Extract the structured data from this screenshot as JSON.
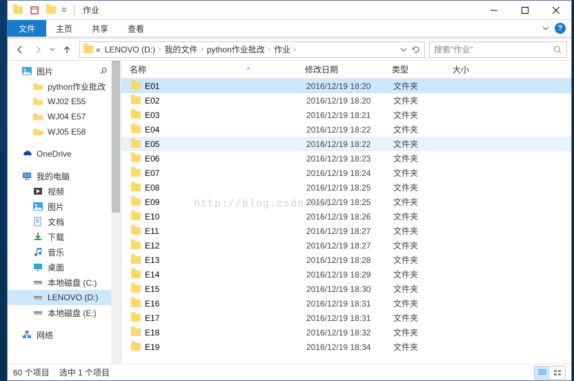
{
  "window": {
    "title": "作业"
  },
  "ribbon": {
    "file_tab": "文件",
    "tabs": [
      "主页",
      "共享",
      "查看"
    ]
  },
  "breadcrumbs": {
    "prefix": "«",
    "items": [
      "LENOVO (D:)",
      "我的文件",
      "python作业批改",
      "作业"
    ]
  },
  "search": {
    "placeholder": "搜索\"作业\""
  },
  "nav_pane": {
    "items": [
      {
        "label": "图片",
        "icon": "pictures",
        "indent": 0,
        "pin": true
      },
      {
        "label": "python作业批改",
        "icon": "folder",
        "indent": 1
      },
      {
        "label": "WJ02 E55",
        "icon": "folder",
        "indent": 1
      },
      {
        "label": "WJ04 E57",
        "icon": "folder",
        "indent": 1
      },
      {
        "label": "WJ05 E58",
        "icon": "folder",
        "indent": 1
      },
      {
        "spacer": true
      },
      {
        "label": "OneDrive",
        "icon": "onedrive",
        "indent": 0
      },
      {
        "spacer": true
      },
      {
        "label": "我的电脑",
        "icon": "thispc",
        "indent": 0
      },
      {
        "label": "视频",
        "icon": "videos",
        "indent": 1
      },
      {
        "label": "图片",
        "icon": "pictures",
        "indent": 1
      },
      {
        "label": "文档",
        "icon": "documents",
        "indent": 1
      },
      {
        "label": "下载",
        "icon": "downloads",
        "indent": 1
      },
      {
        "label": "音乐",
        "icon": "music",
        "indent": 1
      },
      {
        "label": "桌面",
        "icon": "desktop",
        "indent": 1
      },
      {
        "label": "本地磁盘 (C:)",
        "icon": "drive",
        "indent": 1
      },
      {
        "label": "LENOVO (D:)",
        "icon": "drive",
        "indent": 1,
        "selected": true
      },
      {
        "label": "本地磁盘 (E:)",
        "icon": "drive",
        "indent": 1
      },
      {
        "spacer": true
      },
      {
        "label": "网络",
        "icon": "network",
        "indent": 0
      }
    ]
  },
  "columns": {
    "name": "名称",
    "date": "修改日期",
    "type": "类型",
    "size": "大小"
  },
  "files": [
    {
      "name": "E01",
      "date": "2016/12/19 18:20",
      "type": "文件夹",
      "selected": true
    },
    {
      "name": "E02",
      "date": "2016/12/19 18:20",
      "type": "文件夹"
    },
    {
      "name": "E03",
      "date": "2016/12/19 18:21",
      "type": "文件夹"
    },
    {
      "name": "E04",
      "date": "2016/12/19 18:22",
      "type": "文件夹"
    },
    {
      "name": "E05",
      "date": "2016/12/19 18:22",
      "type": "文件夹",
      "hover": true
    },
    {
      "name": "E06",
      "date": "2016/12/19 18:23",
      "type": "文件夹"
    },
    {
      "name": "E07",
      "date": "2016/12/19 18:24",
      "type": "文件夹"
    },
    {
      "name": "E08",
      "date": "2016/12/19 18:25",
      "type": "文件夹"
    },
    {
      "name": "E09",
      "date": "2016/12/19 18:25",
      "type": "文件夹"
    },
    {
      "name": "E10",
      "date": "2016/12/19 18:26",
      "type": "文件夹"
    },
    {
      "name": "E11",
      "date": "2016/12/19 18:27",
      "type": "文件夹"
    },
    {
      "name": "E12",
      "date": "2016/12/19 18:27",
      "type": "文件夹"
    },
    {
      "name": "E13",
      "date": "2016/12/19 18:28",
      "type": "文件夹"
    },
    {
      "name": "E14",
      "date": "2016/12/19 18:29",
      "type": "文件夹"
    },
    {
      "name": "E15",
      "date": "2016/12/19 18:30",
      "type": "文件夹"
    },
    {
      "name": "E16",
      "date": "2016/12/19 18:31",
      "type": "文件夹"
    },
    {
      "name": "E17",
      "date": "2016/12/19 18:31",
      "type": "文件夹"
    },
    {
      "name": "E18",
      "date": "2016/12/19 18:32",
      "type": "文件夹"
    },
    {
      "name": "E19",
      "date": "2016/12/19 18:34",
      "type": "文件夹"
    }
  ],
  "status": {
    "count": "60 个项目",
    "selection": "选中 1 个项目"
  },
  "watermark": "http://blog.csdn.net"
}
